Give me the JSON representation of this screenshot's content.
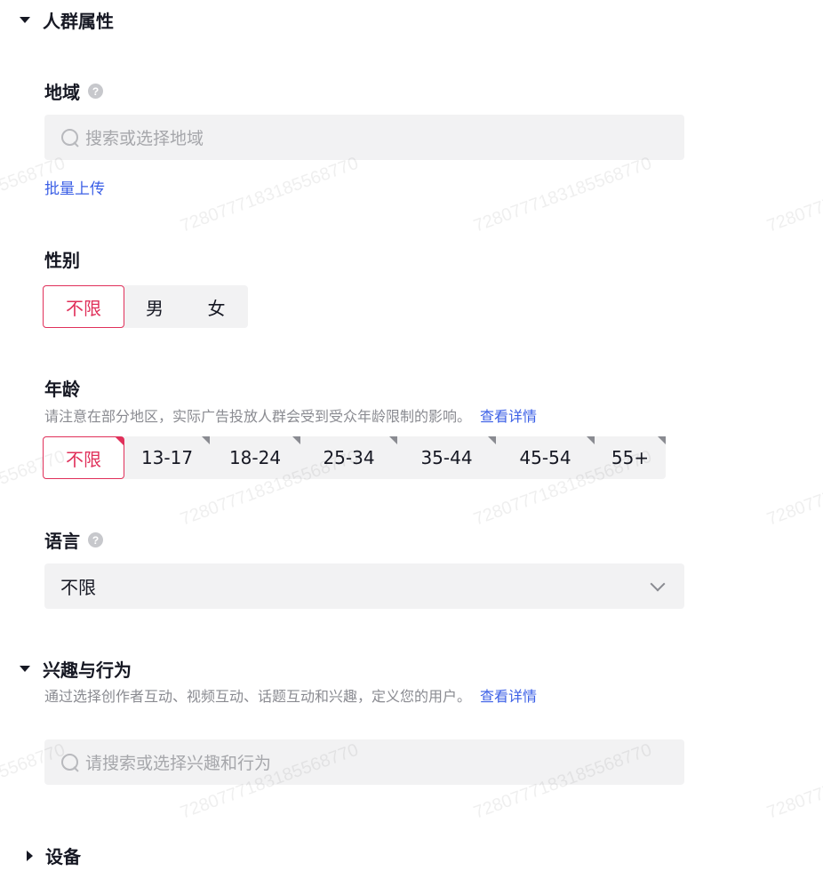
{
  "demographics": {
    "title": "人群属性",
    "location": {
      "label": "地域",
      "placeholder": "搜索或选择地域",
      "bulk_upload": "批量上传"
    },
    "gender": {
      "label": "性别",
      "options": [
        "不限",
        "男",
        "女"
      ],
      "selected": "不限"
    },
    "age": {
      "label": "年龄",
      "hint": "请注意在部分地区，实际广告投放人群会受到受众年龄限制的影响。",
      "hint_link": "查看详情",
      "options": [
        "不限",
        "13-17",
        "18-24",
        "25-34",
        "35-44",
        "45-54",
        "55+"
      ],
      "selected": "不限"
    },
    "language": {
      "label": "语言",
      "value": "不限"
    }
  },
  "interests": {
    "title": "兴趣与行为",
    "hint": "通过选择创作者互动、视频互动、话题互动和兴趣，定义您的用户。",
    "hint_link": "查看详情",
    "placeholder": "请搜索或选择兴趣和行为"
  },
  "devices": {
    "title": "设备"
  },
  "watermark": {
    "text": "7280777183185568770"
  },
  "colors": {
    "accent": "#e0305a",
    "link": "#3b5fe6",
    "field_bg": "#f2f2f3"
  }
}
